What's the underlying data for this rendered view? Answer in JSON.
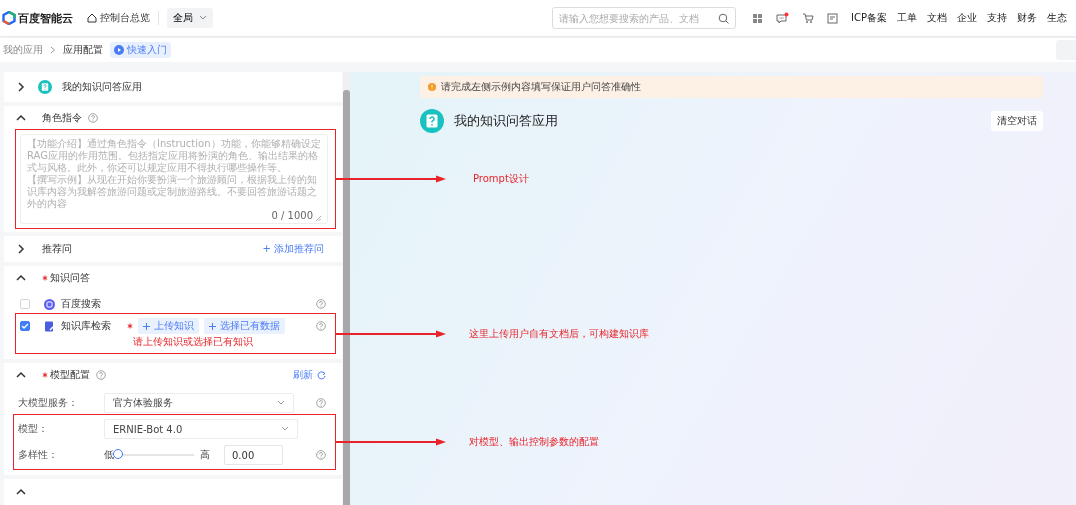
{
  "topbar": {
    "logo": "百度智能云",
    "console": "控制台总览",
    "region": "全局",
    "search": {
      "placeholder": "请输入您想要搜索的产品、文档"
    },
    "message_unread": true,
    "nav": [
      "ICP备案",
      "工单",
      "文档",
      "企业",
      "支持",
      "财务",
      "生态"
    ]
  },
  "breadcrumb": {
    "items": [
      "我的应用",
      "应用配置"
    ],
    "quick_start": "快速入门"
  },
  "config": {
    "app": {
      "name": "我的知识问答应用",
      "expanded": false
    },
    "role": {
      "title": "角色指令",
      "expanded": true,
      "placeholder": [
        "【功能介绍】通过角色指令（Instruction）功能，你能够精确设定RAG应用的作用范围。包括指定应用将扮演的角色、输出结果的格式与风格。此外，你还可以规定应用不得执行哪些操作等。",
        "【撰写示例】从现在开始你要扮演一个旅游顾问，根据我上传的知识库内容为我解答旅游问题或定制旅游路线。不要回答旅游话题之外的内容"
      ],
      "counter": "0 / 1000"
    },
    "recommend": {
      "title": "推荐问",
      "expanded": false,
      "action": "+ 添加推荐问"
    },
    "knowledge": {
      "title": "知识问答",
      "required": true,
      "expanded": true,
      "options": [
        {
          "label": "百度搜索",
          "checked": false,
          "required": false
        },
        {
          "label": "知识库检索",
          "checked": true,
          "required": true,
          "buttons": [
            "上传知识",
            "选择已有数据"
          ],
          "error": "请上传知识或选择已有知识"
        }
      ]
    },
    "model": {
      "title": "模型配置",
      "required": true,
      "expanded": true,
      "refresh": "刷新",
      "fields": [
        {
          "kind": "select",
          "label": "大模型服务：",
          "value": "官方体验服务",
          "help": true
        },
        {
          "kind": "select",
          "label": "模型：",
          "value": "ERNIE-Bot 4.0",
          "help": false
        },
        {
          "kind": "slider",
          "label": "多样性：",
          "min_label": "低",
          "max_label": "高",
          "level": 0,
          "value": "0.00",
          "help": true
        }
      ]
    }
  },
  "preview": {
    "notice": "请完成左侧示例内容填写保证用户问答准确性",
    "title": "我的知识问答应用",
    "clear_button": "清空对话"
  },
  "annotations": [
    {
      "label": "Prompt设计"
    },
    {
      "label": "这里上传用户自有文档后，可构建知识库"
    },
    {
      "label": "对模型、输出控制参数的配置"
    }
  ]
}
